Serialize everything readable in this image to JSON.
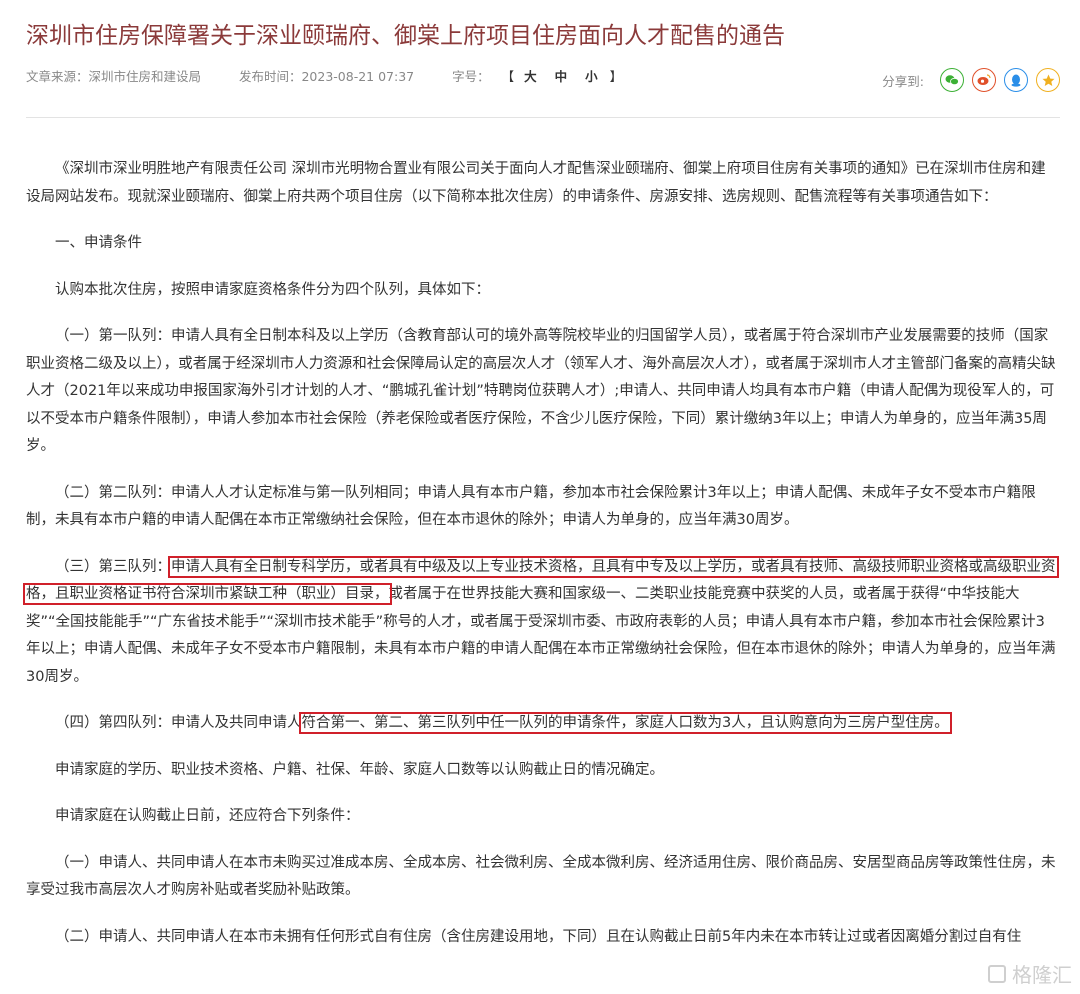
{
  "title": "深圳市住房保障署关于深业颐瑞府、御棠上府项目住房面向人才配售的通告",
  "meta": {
    "source": "文章来源：深圳市住房和建设局",
    "time": "发布时间：2023-08-21 07:37",
    "font_label": "字号：",
    "bracket_open": "【",
    "size_large": "大",
    "size_medium": "中",
    "size_small": "小",
    "bracket_close": "】"
  },
  "share": {
    "label": "分享到:",
    "icons": [
      "wechat-icon",
      "weibo-icon",
      "qq-icon",
      "qzone-icon"
    ],
    "colors": {
      "wechat": "#3cb035",
      "weibo": "#e0502a",
      "qq": "#2a8ee8",
      "qzone": "#f0b020"
    }
  },
  "paragraphs": {
    "p1": "《深圳市深业明胜地产有限责任公司 深圳市光明物合置业有限公司关于面向人才配售深业颐瑞府、御棠上府项目住房有关事项的通知》已在深圳市住房和建设局网站发布。现就深业颐瑞府、御棠上府共两个项目住房（以下简称本批次住房）的申请条件、房源安排、选房规则、配售流程等有关事项通告如下：",
    "p2": "一、申请条件",
    "p3": "认购本批次住房，按照申请家庭资格条件分为四个队列，具体如下：",
    "p4": "（一）第一队列：申请人具有全日制本科及以上学历（含教育部认可的境外高等院校毕业的归国留学人员），或者属于符合深圳市产业发展需要的技师（国家职业资格二级及以上），或者属于经深圳市人力资源和社会保障局认定的高层次人才（领军人才、海外高层次人才），或者属于深圳市人才主管部门备案的高精尖缺人才（2021年以来成功申报国家海外引才计划的人才、“鹏城孔雀计划”特聘岗位获聘人才）;申请人、共同申请人均具有本市户籍（申请人配偶为现役军人的，可以不受本市户籍条件限制），申请人参加本市社会保险（养老保险或者医疗保险，不含少儿医疗保险，下同）累计缴纳3年以上；申请人为单身的，应当年满35周岁。",
    "p5": "（二）第二队列：申请人人才认定标准与第一队列相同；申请人具有本市户籍，参加本市社会保险累计3年以上；申请人配偶、未成年子女不受本市户籍限制，未具有本市户籍的申请人配偶在本市正常缴纳社会保险，但在本市退休的除外；申请人为单身的，应当年满30周岁。",
    "p6_a": "（三）第三队列：",
    "p6_b": "申请人具有全日制专科学历，或者具有中级及以上专业技术资格，且具有中专及以上学历，或者具有技师、高级技师职业资格或高级职业资格，且职业资格证书符合深圳市紧缺工种（职业）目录，",
    "p6_c": "或者属于在世界技能大赛和国家级一、二类职业技能竞赛中获奖的人员，或者属于获得“中华技能大奖”“全国技能能手”“广东省技术能手”“深圳市技术能手”称号的人才，或者属于受深圳市委、市政府表彰的人员；申请人具有本市户籍，参加本市社会保险累计3年以上；申请人配偶、未成年子女不受本市户籍限制，未具有本市户籍的申请人配偶在本市正常缴纳社会保险，但在本市退休的除外；申请人为单身的，应当年满30周岁。",
    "p7_a": "（四）第四队列：申请人及共同申请人",
    "p7_b": "符合第一、第二、第三队列中任一队列的申请条件，家庭人口数为3人，且认购意向为三房户型住房。",
    "p8": "申请家庭的学历、职业技术资格、户籍、社保、年龄、家庭人口数等以认购截止日的情况确定。",
    "p9": "申请家庭在认购截止日前，还应符合下列条件：",
    "p10": "（一）申请人、共同申请人在本市未购买过准成本房、全成本房、社会微利房、全成本微利房、经济适用住房、限价商品房、安居型商品房等政策性住房，未享受过我市高层次人才购房补贴或者奖励补贴政策。",
    "p11": "（二）申请人、共同申请人在本市未拥有任何形式自有住房（含住房建设用地，下同）且在认购截止日前5年内未在本市转让过或者因离婚分割过自有住"
  },
  "watermark": "格隆汇"
}
